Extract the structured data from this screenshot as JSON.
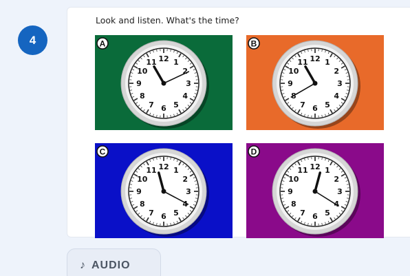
{
  "exercise": {
    "number": "4",
    "instruction": "Look and listen. What's the time?"
  },
  "options": [
    {
      "letter": "A",
      "bg": "#0a6b3a",
      "hour_angle": -30,
      "minute_angle": 65
    },
    {
      "letter": "B",
      "bg": "#e86a2a",
      "hour_angle": -30,
      "minute_angle": 240
    },
    {
      "letter": "C",
      "bg": "#0a10c8",
      "hour_angle": -15,
      "minute_angle": 118
    },
    {
      "letter": "D",
      "bg": "#8a0a8a",
      "hour_angle": 15,
      "minute_angle": 122
    }
  ],
  "clock_numbers": [
    "12",
    "1",
    "2",
    "3",
    "4",
    "5",
    "6",
    "7",
    "8",
    "9",
    "10",
    "11"
  ],
  "audio_button": {
    "icon": "music-note-icon",
    "label": "AUDIO"
  }
}
